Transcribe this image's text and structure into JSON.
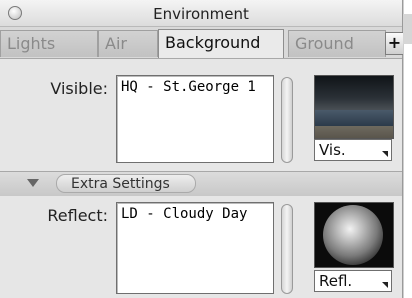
{
  "window": {
    "title": "Environment"
  },
  "tabs": [
    {
      "label": "Lights",
      "active": false
    },
    {
      "label": "Air",
      "active": false
    },
    {
      "label": "Background",
      "active": true
    },
    {
      "label": "Ground",
      "active": false
    }
  ],
  "tab_add_label": "+",
  "visible": {
    "label": "Visible:",
    "value": "HQ - St.George 1",
    "popup": "Vis."
  },
  "extra": {
    "label": "Extra Settings"
  },
  "reflect": {
    "label": "Reflect:",
    "value": "LD - Cloudy Day",
    "popup": "Refl."
  },
  "icons": {
    "close": "close-circle-icon",
    "disclosure": "disclosure-triangle-icon",
    "popup_arrow": "dropdown-arrow-icon"
  }
}
